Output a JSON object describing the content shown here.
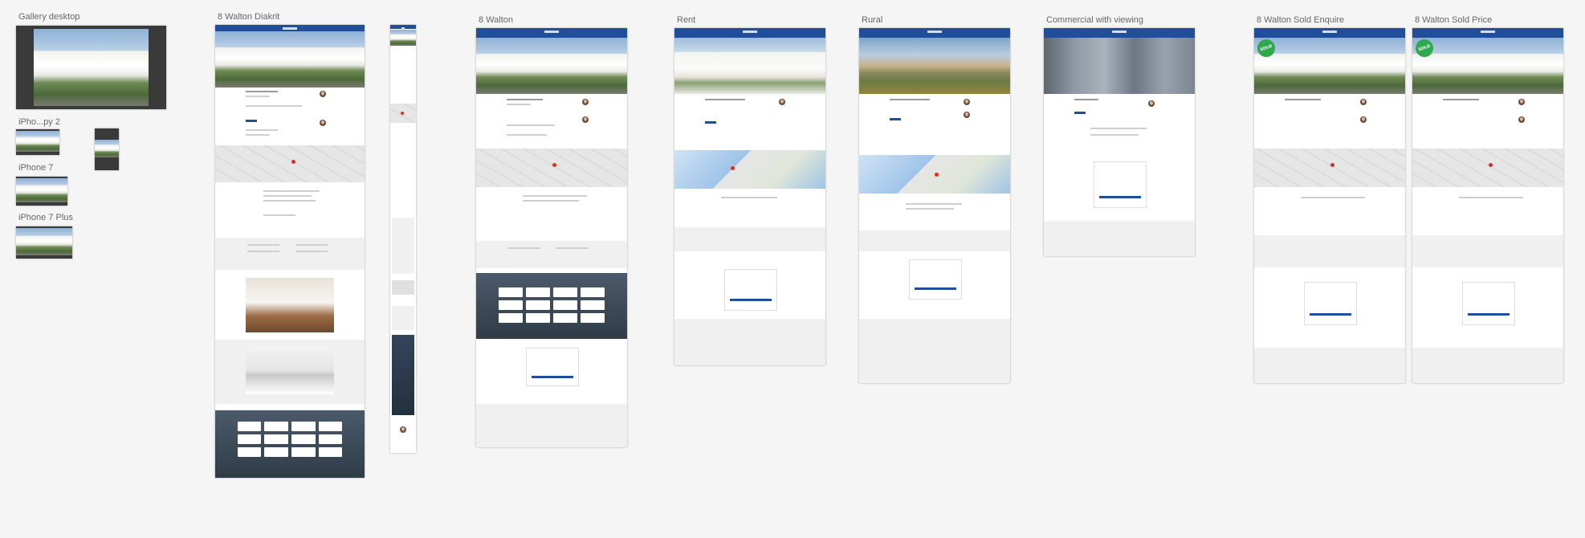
{
  "artboards": {
    "gallery_desktop": "Gallery desktop",
    "iphone_copy2": "iPho...py 2",
    "iphone7": "iPhone 7",
    "iphone7plus": "iPhone 7 Plus",
    "walton_diakrit": "8 Walton Diakrit",
    "walton": "8 Walton",
    "rent": "Rent",
    "rural": "Rural",
    "commercial": "Commercial with viewing",
    "sold_enquire": "8 Walton Sold Enquire",
    "sold_price": "8 Walton Sold Price"
  },
  "badges": {
    "sold": "SOLD"
  },
  "colors": {
    "brand": "#1f4f9a",
    "sold": "#2fa84f",
    "pin": "#d93025",
    "canvas": "#f5f5f5"
  }
}
